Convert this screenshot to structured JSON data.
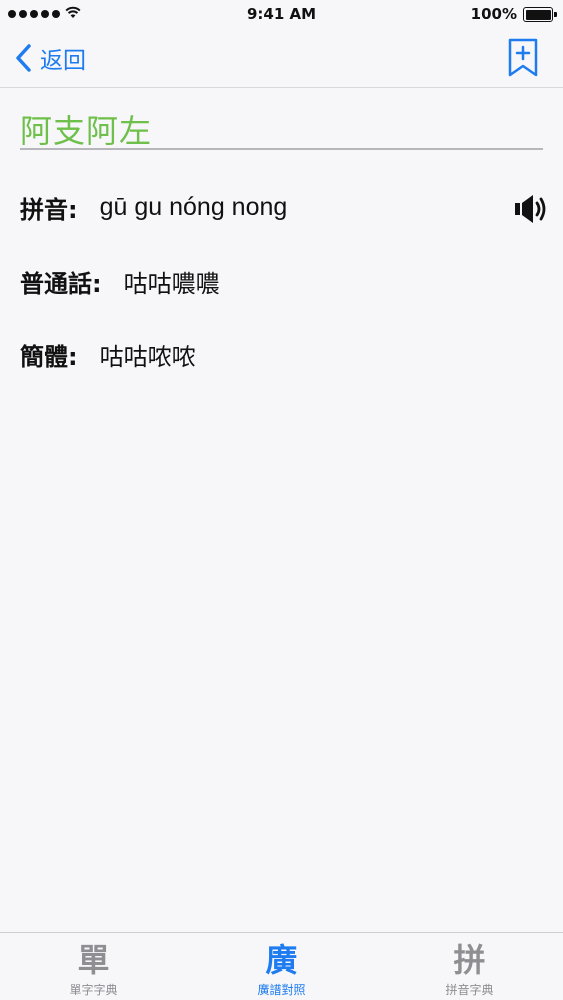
{
  "status_bar": {
    "time": "9:41 AM",
    "battery_percent": "100%",
    "battery_level": 1.0,
    "signal_bars": 5
  },
  "nav": {
    "back_label": "返回",
    "back_icon": "chevron-left-icon",
    "bookmark_icon": "bookmark-add-icon"
  },
  "entry": {
    "headword": "阿支阿左",
    "pinyin_label": "拼音:",
    "pinyin_value": "gū gu nóng nong",
    "mandarin_label": "普通話:",
    "mandarin_value": "咕咕噥噥",
    "simplified_label": "簡體:",
    "simplified_value": "咕咕哝哝",
    "speaker_icon": "speaker-icon"
  },
  "tabs": [
    {
      "glyph": "單",
      "label": "單字字典",
      "active": false
    },
    {
      "glyph": "廣",
      "label": "廣譜對照",
      "active": true
    },
    {
      "glyph": "拼",
      "label": "拼音字典",
      "active": false
    }
  ],
  "colors": {
    "accent": "#1e7cf0",
    "headword": "#6ec04a",
    "inactive": "#8e8e93",
    "background": "#f7f7f9"
  }
}
